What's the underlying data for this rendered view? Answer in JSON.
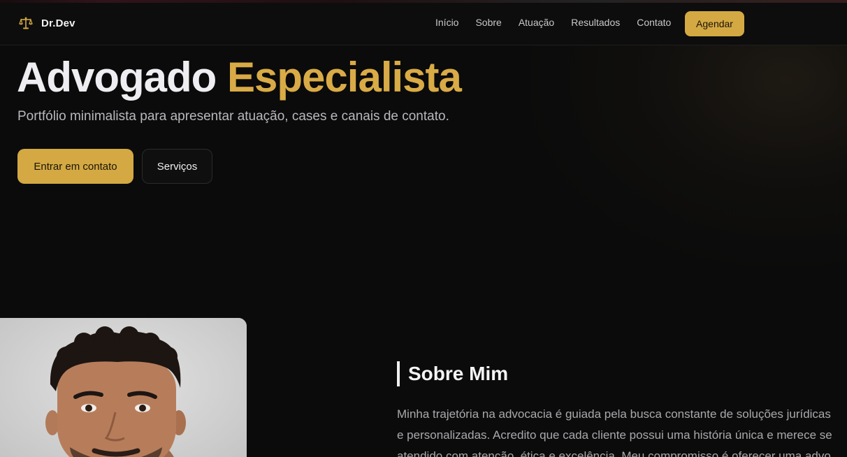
{
  "brand": {
    "name": "Dr.Dev",
    "icon": "scales-of-justice-icon",
    "accent": "#d4a943"
  },
  "nav": {
    "links": [
      "Início",
      "Sobre",
      "Atuação",
      "Resultados",
      "Contato"
    ],
    "cta": "Agendar"
  },
  "hero": {
    "title_white": "Advogado",
    "title_gold": "Especialista",
    "subtitle": "Portfólio minimalista para apresentar atuação, cases e canais de contato.",
    "primary_button": "Entrar em contato",
    "secondary_button": "Serviços"
  },
  "about": {
    "heading": "Sobre Mim",
    "photo_alt": "portrait-photo",
    "lines": [
      "Minha trajetória na advocacia é guiada pela busca constante de soluções jurídicas",
      "e personalizadas. Acredito que cada cliente possui uma história única e merece se",
      "atendido com atenção, ética e excelência. Meu compromisso é oferecer uma advo"
    ]
  },
  "colors": {
    "background": "#0b0b0b",
    "gold": "#d9ab46",
    "button_gold": "#d4a943"
  }
}
